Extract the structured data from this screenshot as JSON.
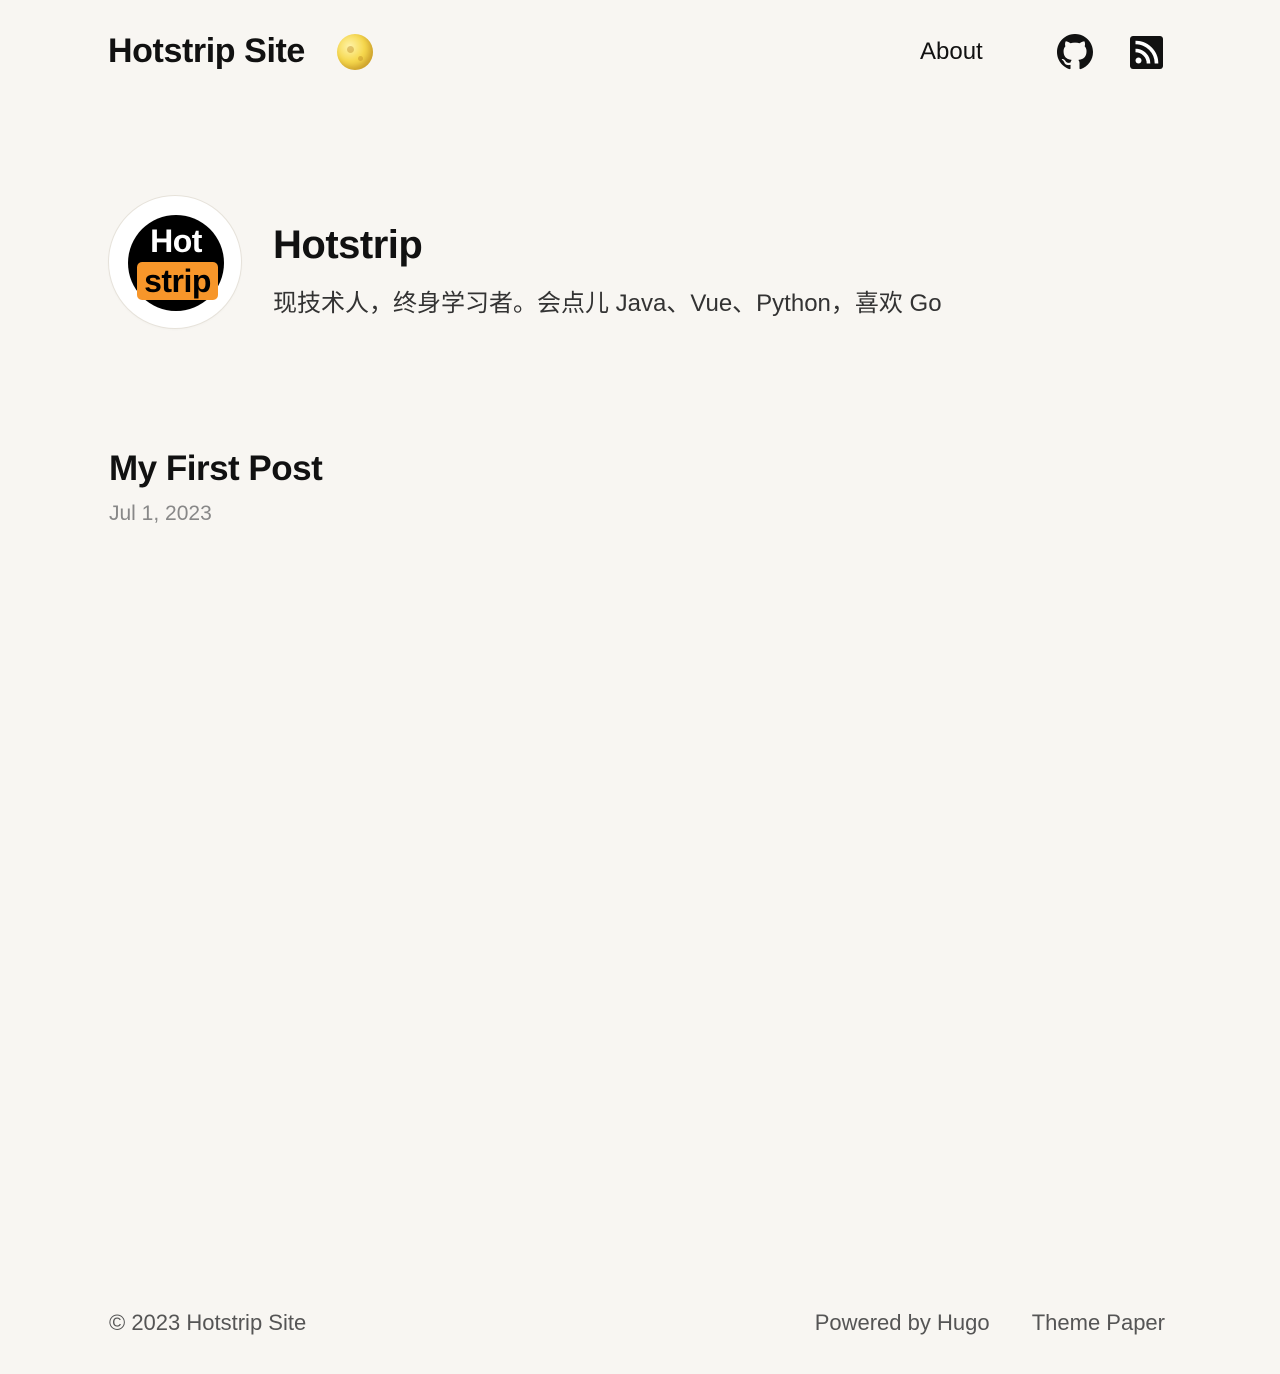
{
  "header": {
    "site_title": "Hotstrip Site",
    "theme_toggle_icon": "moon-icon",
    "nav": {
      "about_label": "About",
      "github_icon": "github-icon",
      "rss_icon": "rss-icon"
    }
  },
  "profile": {
    "avatar_text_top": "Hot",
    "avatar_text_bottom": "strip",
    "avatar_accent_color": "#f7962a",
    "name": "Hotstrip",
    "bio": "现技术人，终身学习者。会点儿 Java、Vue、Python，喜欢 Go"
  },
  "posts": [
    {
      "title": "My First Post",
      "date": "Jul 1, 2023"
    }
  ],
  "footer": {
    "copyright": "© 2023 Hotstrip Site",
    "powered_by": "Powered by Hugo",
    "theme": "Theme Paper"
  },
  "colors": {
    "background": "#f8f6f2",
    "text": "#111111",
    "muted": "#888888"
  }
}
